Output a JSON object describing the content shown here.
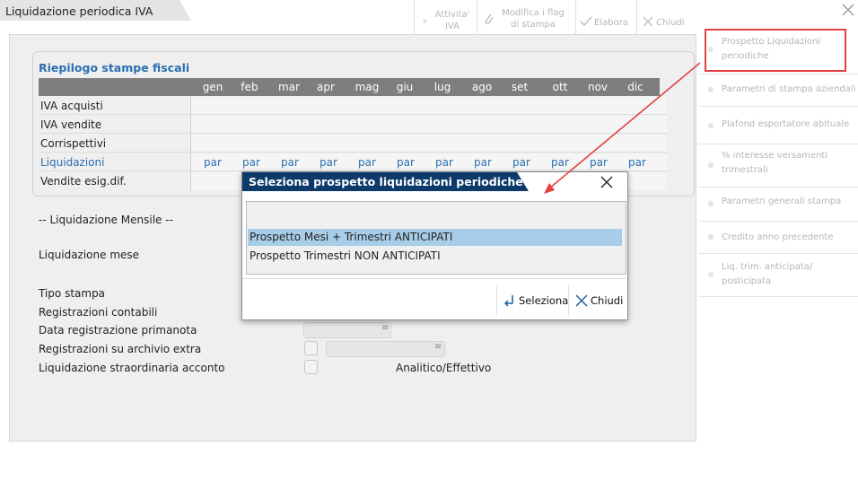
{
  "window": {
    "title": "Liquidazione periodica IVA"
  },
  "summary": {
    "title": "Riepilogo stampe fiscali",
    "months": [
      "gen",
      "feb",
      "mar",
      "apr",
      "mag",
      "giu",
      "lug",
      "ago",
      "set",
      "ott",
      "nov",
      "dic"
    ],
    "rows": [
      "IVA acquisti",
      "IVA vendite",
      "Corrispettivi",
      "Liquidazioni",
      "Vendite esig.dif."
    ],
    "liquidazioni_values": [
      "par",
      "par",
      "par",
      "par",
      "par",
      "par",
      "par",
      "par",
      "par",
      "par",
      "par",
      "par"
    ]
  },
  "form": {
    "section_label": "-- Liquidazione Mensile --",
    "liquidazione_mese_label": "Liquidazione mese",
    "tipo_stampa_label": "Tipo stampa",
    "registrazioni_contabili_label": "Registrazioni contabili",
    "data_registrazione_label": "Data registrazione primanota",
    "registrazioni_extra_label": "Registrazioni su archivio extra",
    "liquidazione_straordinaria_label": "Liquidazione straordinaria acconto",
    "analitico_label": "Analitico/Effettivo"
  },
  "right_panel": {
    "items": [
      {
        "line1": "Prospetto Liquidazioni",
        "line2": "periodiche"
      },
      {
        "line1": "Parametri di stampa aziendali",
        "line2": ""
      },
      {
        "line1": "Plafond esportatore abituale",
        "line2": ""
      },
      {
        "line1": "% interesse versamenti",
        "line2": "trimestrali"
      },
      {
        "line1": "Parametri generali stampa",
        "line2": ""
      },
      {
        "line1": "Credito anno precedente",
        "line2": ""
      },
      {
        "line1": "Liq. trim. anticipata/",
        "line2": "posticipata"
      }
    ]
  },
  "bottom_bar": {
    "attivita_line1": "Attivita'",
    "attivita_line2": "IVA",
    "modifica_line1": "Modifica i flag",
    "modifica_line2": "di stampa",
    "elabora": "Elabora",
    "chiudi": "Chiudi"
  },
  "dialog": {
    "title": "Seleziona prospetto liquidazioni periodiche",
    "options": [
      "Prospetto Mesi + Trimestri ANTICIPATI",
      "Prospetto Trimestri NON ANTICIPATI"
    ],
    "selected_index": 0,
    "seleziona_label": "Seleziona",
    "chiudi_label": "Chiudi"
  },
  "colors": {
    "accent": "#2b6fb0",
    "dialog_title_bg": "#0d3a6b",
    "selection": "#a8cde8",
    "annotation": "#e34040"
  }
}
